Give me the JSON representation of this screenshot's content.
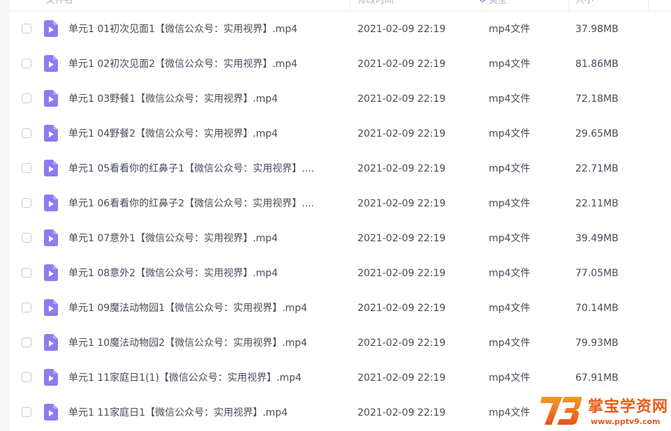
{
  "header": {
    "name_label": "文件名",
    "modified_label": "修改时间",
    "type_label": "类型",
    "size_label": "大小"
  },
  "colors": {
    "icon_accent": "#8c7cf0",
    "text": "#454d5a",
    "watermark": "#e85a18"
  },
  "files": [
    {
      "name": "单元1   01初次见面1【微信公众号：实用视界】.mp4",
      "modified": "2021-02-09 22:19",
      "type": "mp4文件",
      "size": "37.98MB",
      "icon": "video-file-icon"
    },
    {
      "name": "单元1   02初次见面2【微信公众号：实用视界】.mp4",
      "modified": "2021-02-09 22:19",
      "type": "mp4文件",
      "size": "81.86MB",
      "icon": "video-file-icon"
    },
    {
      "name": "单元1   03野餐1【微信公众号：实用视界】.mp4",
      "modified": "2021-02-09 22:19",
      "type": "mp4文件",
      "size": "72.18MB",
      "icon": "video-file-icon"
    },
    {
      "name": "单元1   04野餐2【微信公众号：实用视界】.mp4",
      "modified": "2021-02-09 22:19",
      "type": "mp4文件",
      "size": "29.65MB",
      "icon": "video-file-icon"
    },
    {
      "name": "单元1   05看看你的红鼻子1【微信公众号：实用视界】....",
      "modified": "2021-02-09 22:19",
      "type": "mp4文件",
      "size": "22.71MB",
      "icon": "video-file-icon"
    },
    {
      "name": "单元1   06看看你的红鼻子2【微信公众号：实用视界】....",
      "modified": "2021-02-09 22:19",
      "type": "mp4文件",
      "size": "22.11MB",
      "icon": "video-file-icon"
    },
    {
      "name": "单元1   07意外1【微信公众号：实用视界】.mp4",
      "modified": "2021-02-09 22:19",
      "type": "mp4文件",
      "size": "39.49MB",
      "icon": "video-file-icon"
    },
    {
      "name": "单元1   08意外2【微信公众号：实用视界】.mp4",
      "modified": "2021-02-09 22:19",
      "type": "mp4文件",
      "size": "77.05MB",
      "icon": "video-file-icon"
    },
    {
      "name": "单元1   09魔法动物园1【微信公众号：实用视界】.mp4",
      "modified": "2021-02-09 22:19",
      "type": "mp4文件",
      "size": "70.14MB",
      "icon": "video-file-icon"
    },
    {
      "name": "单元1   10魔法动物园2【微信公众号：实用视界】.mp4",
      "modified": "2021-02-09 22:19",
      "type": "mp4文件",
      "size": "79.93MB",
      "icon": "video-file-icon"
    },
    {
      "name": "单元1   11家庭日1(1)【微信公众号：实用视界】.mp4",
      "modified": "2021-02-09 22:19",
      "type": "mp4文件",
      "size": "67.91MB",
      "icon": "video-file-icon"
    },
    {
      "name": "单元1   11家庭日1【微信公众号：实用视界】.mp4",
      "modified": "2021-02-09 22:19",
      "type": "mp4文件",
      "size": "",
      "icon": "video-file-icon"
    }
  ],
  "watermark": {
    "title": "掌宝学资网",
    "url": "www.pptv9.com",
    "logo_text": "73"
  }
}
